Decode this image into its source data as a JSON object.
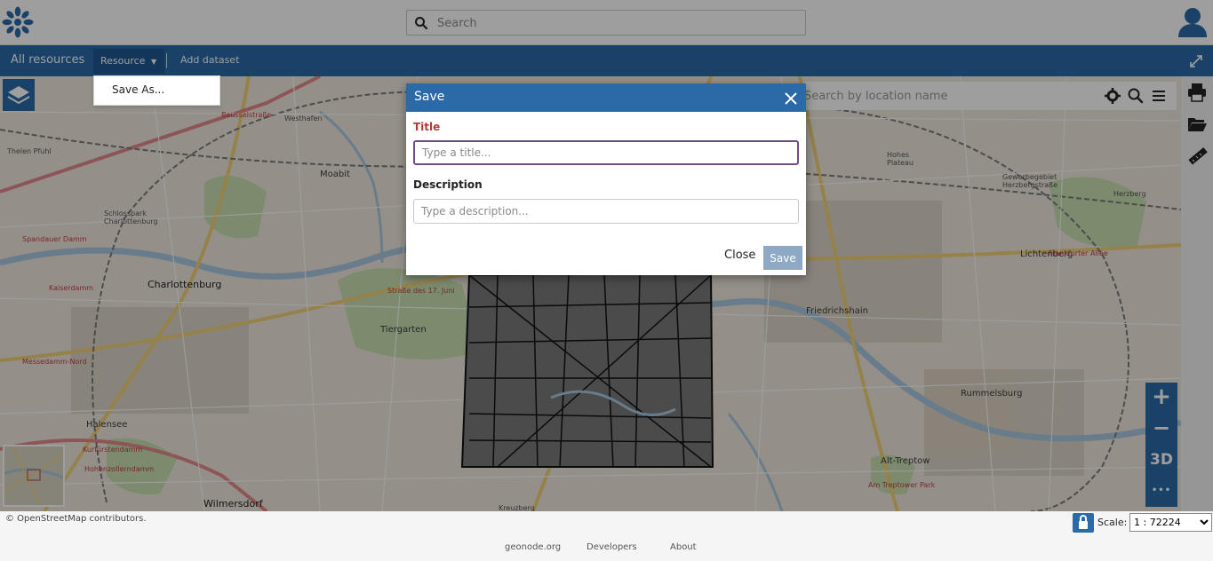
{
  "header": {
    "search_placeholder": "Search"
  },
  "nav": {
    "all_resources": "All resources",
    "resource_menu": "Resource",
    "add_dataset": "Add dataset"
  },
  "resource_dropdown": {
    "items": [
      "Save As..."
    ]
  },
  "map": {
    "location_search_placeholder": "Search by location name",
    "labels": [
      "Moabit",
      "Charlottenburg",
      "Tiergarten",
      "Friedrichshain",
      "Lichtenberg",
      "Rummelsburg",
      "Halensee",
      "Wilmersdorf",
      "Alt-Treptow",
      "Kreuzberg",
      "Westhafen",
      "Thelen Pfuhl",
      "Schlosspark Charlottenburg",
      "Spandauer Damm",
      "Kaiserdamm",
      "Messedamm-Nord",
      "Kurfürstendamm",
      "Hohenzollerndamm",
      "Beusselstraße",
      "Straße des 17. Juni",
      "Gewerbegebiet Herzbergstraße",
      "Herzberg",
      "Frankfurter Allee",
      "Am Treptower Park",
      "Hohes Plateau"
    ],
    "zoom_in": "+",
    "zoom_out": "−",
    "mode_3d": "3D",
    "more": "•••"
  },
  "save_dialog": {
    "title": "Save",
    "title_label": "Title",
    "title_placeholder": "Type a title...",
    "description_label": "Description",
    "description_placeholder": "Type a description...",
    "close_label": "Close",
    "save_label": "Save"
  },
  "map_footer": {
    "attribution": "© OpenStreetMap contributors.",
    "scale_label": "Scale:",
    "scale_value": "1 : 72224"
  },
  "page_footer": {
    "links": [
      "geonode.org",
      "Developers",
      "About"
    ]
  },
  "colors": {
    "primary": "#2b6aa6",
    "required_label": "#b73a3a",
    "save_disabled": "#8ea9c4"
  }
}
